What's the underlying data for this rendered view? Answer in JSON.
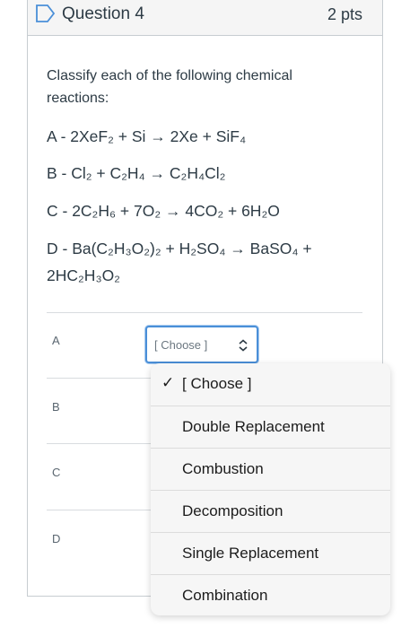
{
  "question": {
    "title": "Question 4",
    "points": "2 pts",
    "prompt": "Classify each of the following chemical reactions:"
  },
  "reactions": {
    "A": "A - 2XeF₂ + Si → 2Xe + SiF₄",
    "B": "B - Cl₂ + C₂H₄ → C₂H₄Cl₂",
    "C": "C - 2C₂H₆ + 7O₂ → 4CO₂ + 6H₂O",
    "D": "D - Ba(C₂H₃O₂)₂ + H₂SO₄ → BaSO₄ + 2HC₂H₃O₂"
  },
  "rows": {
    "labels": [
      "A",
      "B",
      "C",
      "D"
    ]
  },
  "select": {
    "value": "[ Choose ]"
  },
  "dropdown": {
    "options": [
      "[ Choose ]",
      "Double Replacement",
      "Combustion",
      "Decomposition",
      "Single Replacement",
      "Combination"
    ],
    "selected_check": "✓"
  },
  "colors": {
    "accent": "#4a8fd8",
    "header_bg": "#f5f5f5",
    "text": "#2d3b45"
  }
}
